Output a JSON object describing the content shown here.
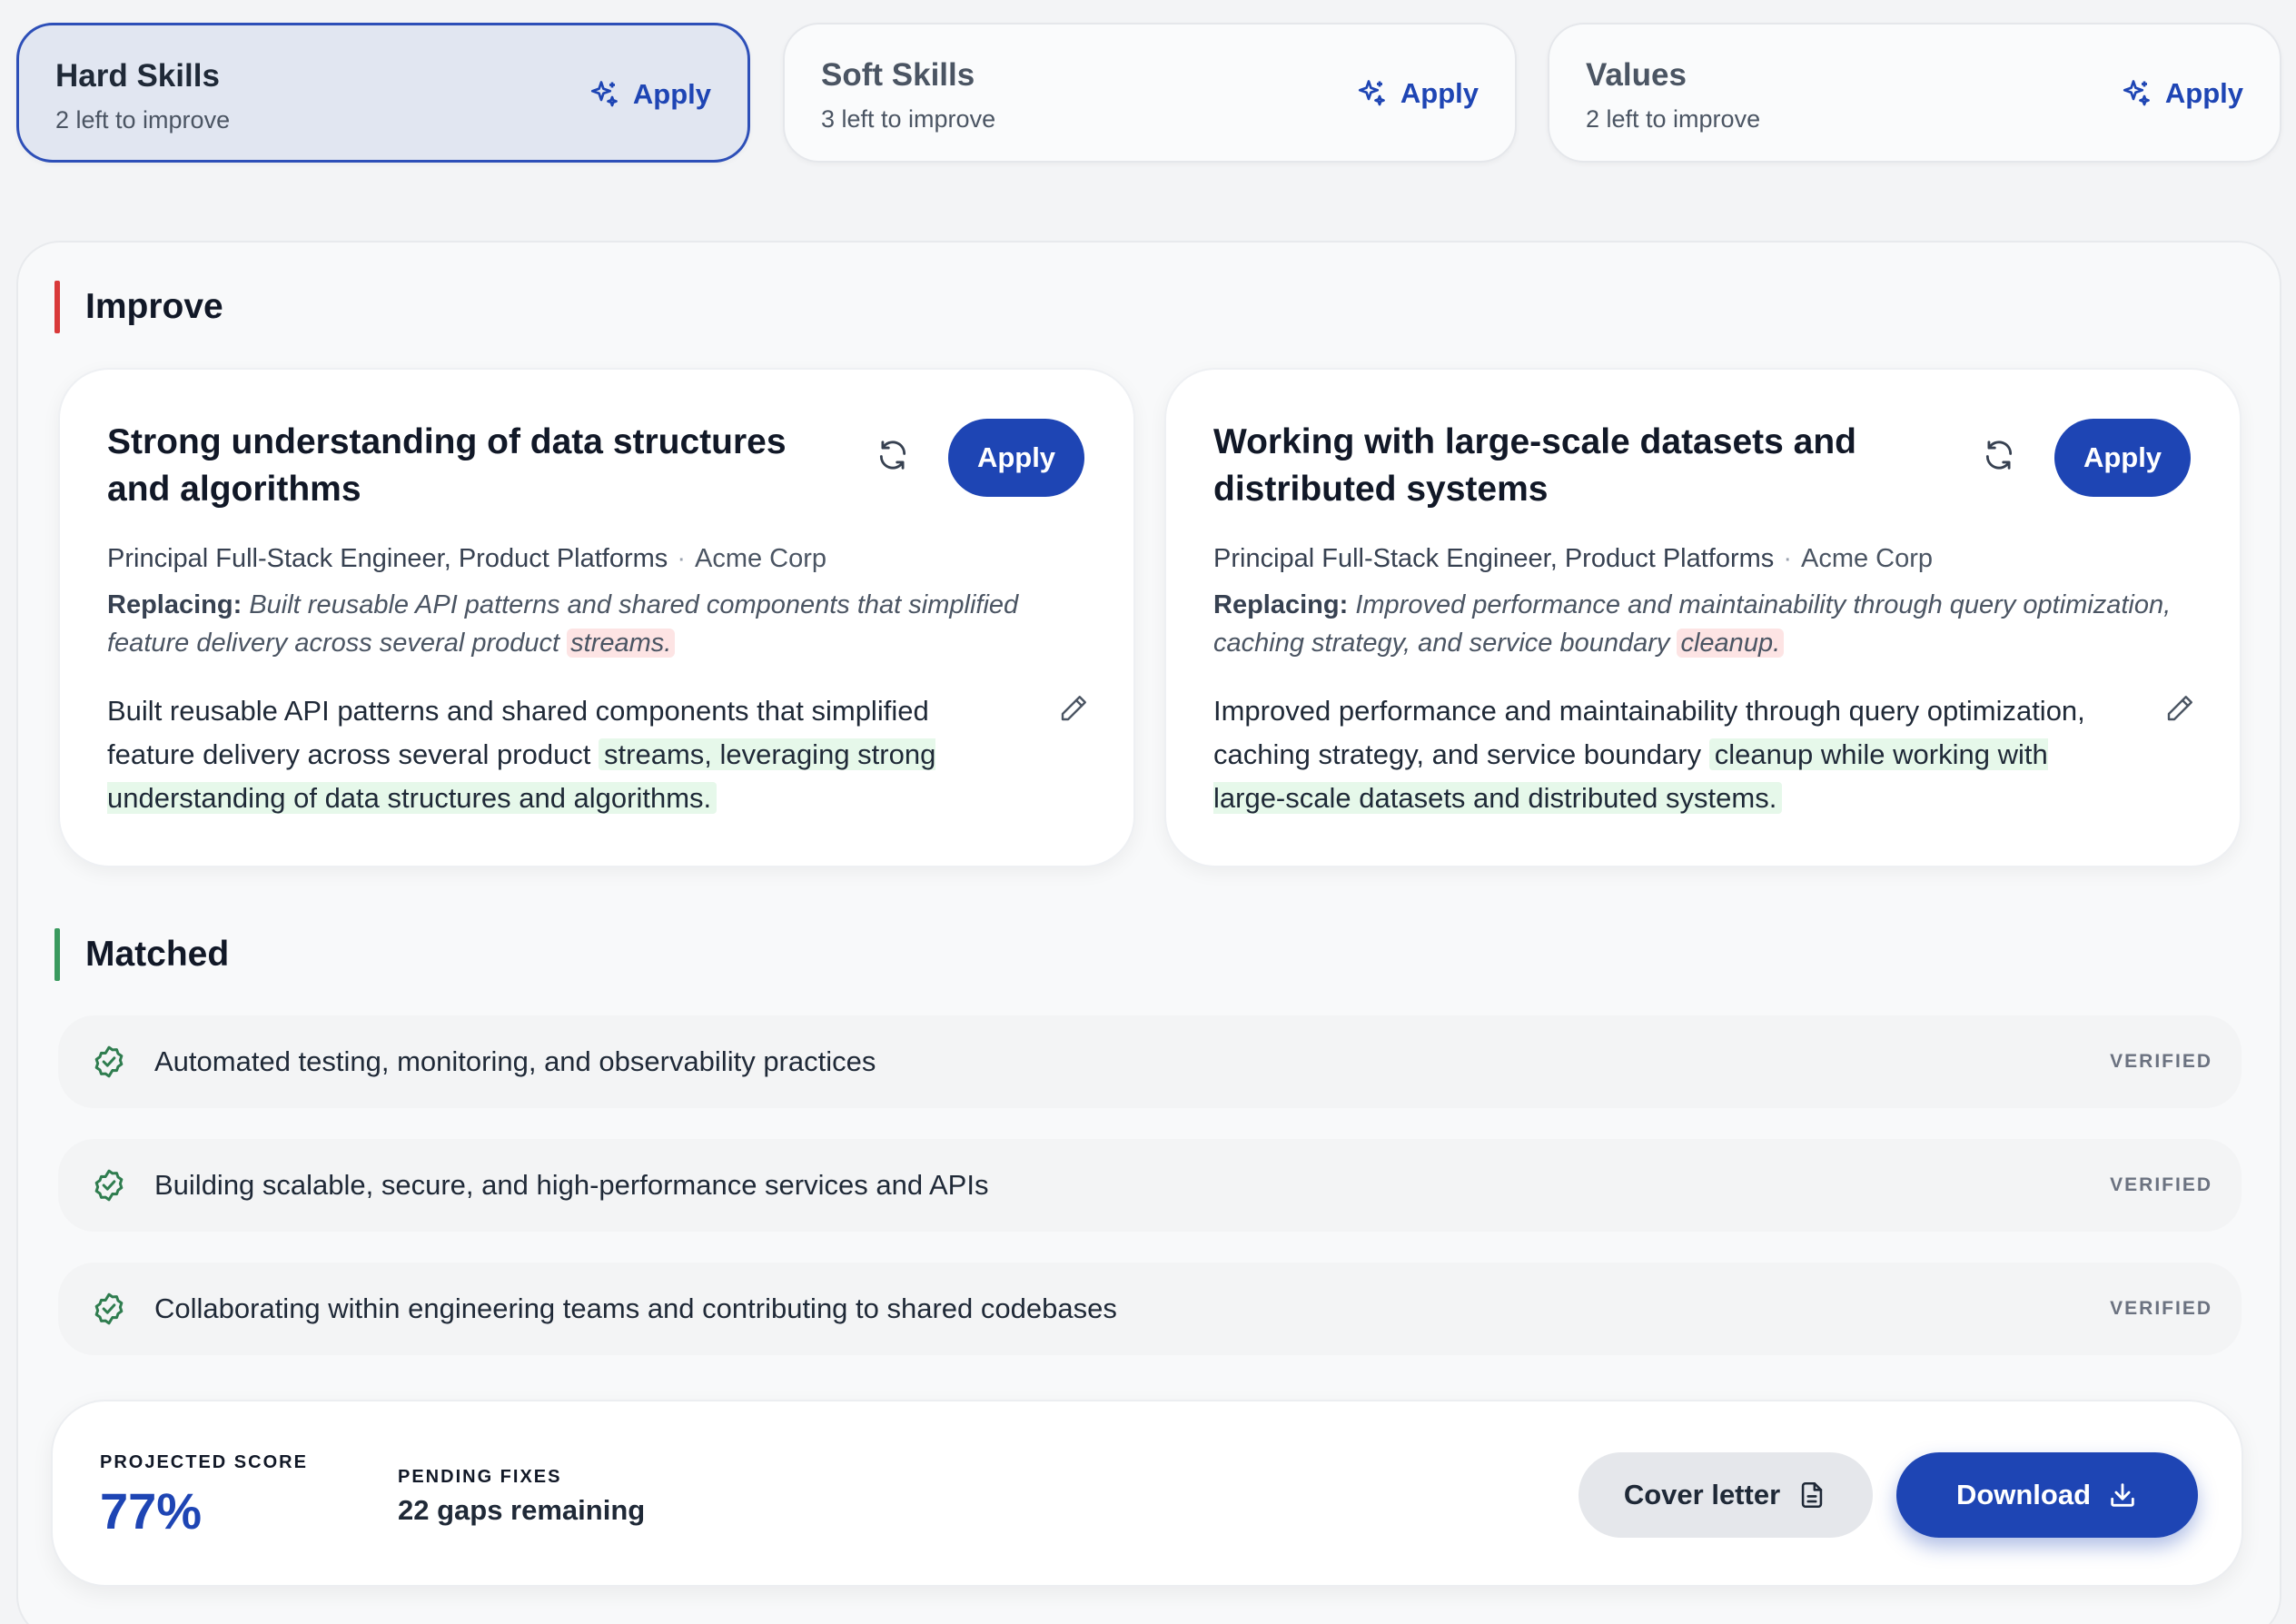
{
  "categories": [
    {
      "title": "Hard Skills",
      "subtitle": "2 left to improve",
      "apply_label": "Apply",
      "active": true
    },
    {
      "title": "Soft Skills",
      "subtitle": "3 left to improve",
      "apply_label": "Apply",
      "active": false
    },
    {
      "title": "Values",
      "subtitle": "2 left to improve",
      "apply_label": "Apply",
      "active": false
    }
  ],
  "improve": {
    "heading": "Improve",
    "accent_color": "#d93a3a",
    "cards": [
      {
        "title": "Strong understanding of data structures and algorithms",
        "apply_label": "Apply",
        "role": "Principal Full-Stack Engineer, Product Platforms",
        "separator": "·",
        "company": "Acme Corp",
        "replacing_label": "Replacing:",
        "replacing_text": "Built reusable API patterns and shared components that simplified feature delivery across several product",
        "replacing_removed": "streams.",
        "new_text": "Built reusable API patterns and shared components that simplified feature delivery across several product",
        "new_added": "streams, leveraging strong understanding of data structures and algorithms."
      },
      {
        "title": "Working with large-scale datasets and distributed systems",
        "apply_label": "Apply",
        "role": "Principal Full-Stack Engineer, Product Platforms",
        "separator": "·",
        "company": "Acme Corp",
        "replacing_label": "Replacing:",
        "replacing_text": "Improved performance and maintainability through query optimization, caching strategy, and service boundary",
        "replacing_removed": "cleanup.",
        "new_text": "Improved performance and maintainability through query optimization, caching strategy, and service boundary",
        "new_added": "cleanup while working with large-scale datasets and distributed systems."
      }
    ]
  },
  "matched": {
    "heading": "Matched",
    "accent_color": "#3a9a5e",
    "items": [
      {
        "text": "Automated testing, monitoring, and observability practices",
        "status": "VERIFIED"
      },
      {
        "text": "Building scalable, secure, and high-performance services and APIs",
        "status": "VERIFIED"
      },
      {
        "text": "Collaborating within engineering teams and contributing to shared codebases",
        "status": "VERIFIED"
      }
    ]
  },
  "footer": {
    "projected_label": "PROJECTED SCORE",
    "projected_value": "77%",
    "pending_label": "PENDING FIXES",
    "pending_value": "22 gaps remaining",
    "cover_letter_label": "Cover letter",
    "download_label": "Download"
  },
  "colors": {
    "primary": "#1e45b4",
    "removed_highlight": "#fde4e4",
    "added_highlight": "#e6f8ea",
    "verified_check": "#2f7d4f"
  },
  "icons": {
    "apply": "sparkle-icon",
    "regenerate": "refresh-icon",
    "edit": "pencil-icon",
    "verified": "check-badge-icon",
    "cover_letter": "document-icon",
    "download": "download-icon"
  }
}
